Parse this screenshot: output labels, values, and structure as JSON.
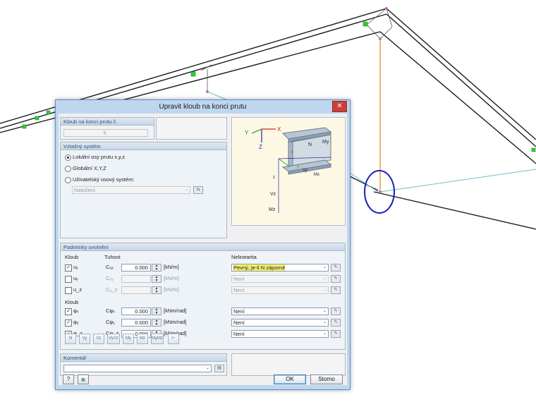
{
  "dialog": {
    "title": "Upravit kloub na konci prutu",
    "close_label": "✕",
    "hinge_no": {
      "label": "Kloub na konci prutu č.",
      "value": "5"
    },
    "ref_system": {
      "title": "Vztažný systém",
      "options": [
        "Lokální osy prutu x,y,z",
        "Globální X,Y,Z",
        "Uživatelský osový systém:"
      ],
      "selected_index": 0,
      "rotation_placeholder": "Natočení"
    },
    "release": {
      "title": "Podmínky uvolnění",
      "col_hinge": "Kloub",
      "col_stiffness": "Tuhost",
      "col_nonlinearity": "Nelinearita",
      "translation_rows": [
        {
          "dof": "uₓ",
          "checked": true,
          "coef": "Cᵤₓ",
          "colon": ":",
          "value": "0.000",
          "unit": "[kN/m]",
          "nonlinear": "Pevný, je-li N záporné",
          "enabled": true,
          "highlight": true
        },
        {
          "dof": "uᵧ",
          "checked": false,
          "coef": "Cᵤᵧ",
          "colon": ":",
          "value": "",
          "unit": "[kN/m]",
          "nonlinear": "Není",
          "enabled": false,
          "highlight": false
        },
        {
          "dof": "u_z",
          "checked": false,
          "coef": "Cᵤ_z",
          "colon": ":",
          "value": "",
          "unit": "[kN/m]",
          "nonlinear": "Není",
          "enabled": false,
          "highlight": false
        }
      ],
      "rotation_label": "Kloub",
      "rotation_rows": [
        {
          "dof": "φₓ",
          "checked": true,
          "coef": "Cφₓ",
          "colon": ":",
          "value": "0.000",
          "unit": "[kNm/rad]",
          "nonlinear": "Není",
          "enabled": true,
          "highlight": false
        },
        {
          "dof": "φᵧ",
          "checked": true,
          "coef": "Cφᵧ",
          "colon": ":",
          "value": "0.000",
          "unit": "[kNm/rad]",
          "nonlinear": "Není",
          "enabled": true,
          "highlight": false
        },
        {
          "dof": "φ_z",
          "checked": true,
          "coef": "Cφ_z",
          "colon": ":",
          "value": "0.000",
          "unit": "[kNm/rad]",
          "nonlinear": "Není",
          "enabled": true,
          "highlight": false
        }
      ],
      "toolbar": [
        "N",
        "Vy",
        "Vz",
        "VyVz",
        "My",
        "Mz",
        "MyMz",
        "⊢"
      ]
    },
    "comment": {
      "label": "Komentář",
      "value": ""
    },
    "footer": {
      "ok": "OK",
      "cancel": "Storno",
      "help_icon": "help-icon",
      "units_icon": "units-icon"
    },
    "diagram": {
      "axes_global": [
        "X",
        "Y",
        "Z"
      ],
      "labels": [
        "N",
        "My",
        "y",
        "x",
        "z",
        "Vy",
        "Vz",
        "Mz",
        "Mx",
        "y",
        "z"
      ]
    }
  },
  "colors": {
    "accent": "#3c7fb1",
    "highlight": "#f4ef6b",
    "close": "#c7413a"
  }
}
